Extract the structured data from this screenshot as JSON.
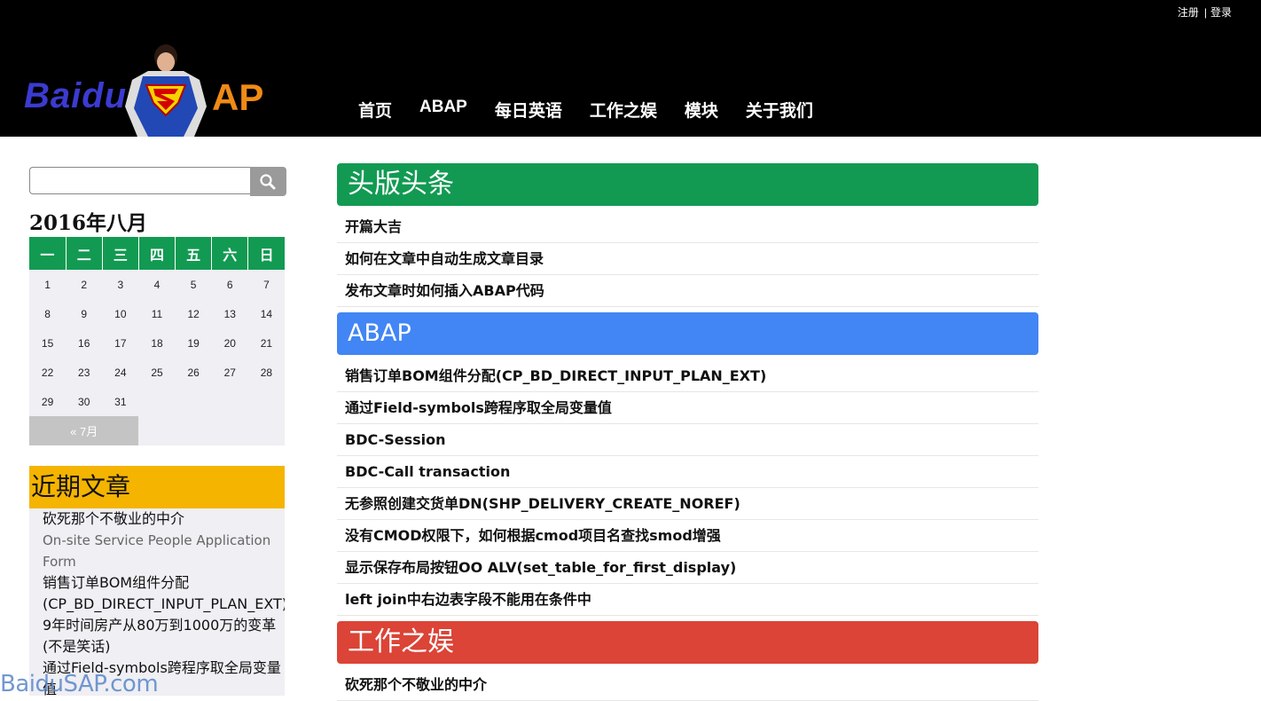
{
  "header": {
    "top_links": [
      "注册",
      "登录"
    ],
    "logo": {
      "left_text": "Baidu",
      "right_text": "AP"
    },
    "nav": [
      "首页",
      "ABAP",
      "每日英语",
      "工作之娱",
      "模块",
      "关于我们"
    ]
  },
  "sidebar": {
    "search": {
      "value": "",
      "icon": "search-icon"
    },
    "calendar": {
      "title": "2016年八月",
      "weekdays": [
        "一",
        "二",
        "三",
        "四",
        "五",
        "六",
        "日"
      ],
      "weeks": [
        [
          "1",
          "2",
          "3",
          "4",
          "5",
          "6",
          "7"
        ],
        [
          "8",
          "9",
          "10",
          "11",
          "12",
          "13",
          "14"
        ],
        [
          "15",
          "16",
          "17",
          "18",
          "19",
          "20",
          "21"
        ],
        [
          "22",
          "23",
          "24",
          "25",
          "26",
          "27",
          "28"
        ],
        [
          "29",
          "30",
          "31",
          "",
          "",
          "",
          ""
        ]
      ],
      "prev_link": "« 7月"
    },
    "recent": {
      "title": "近期文章",
      "items": [
        "砍死那个不敬业的中介",
        "On-site Service People Application Form",
        "销售订单BOM组件分配(CP_BD_DIRECT_INPUT_PLAN_EXT)",
        "9年时间房产从80万到1000万的变革(不是笑话)",
        "通过Field-symbols跨程序取全局变量值"
      ]
    }
  },
  "watermark": "BaiduSAP.com",
  "sections": [
    {
      "title": "头版头条",
      "color": "#129a52",
      "items": [
        "开篇大吉",
        "如何在文章中自动生成文章目录",
        "发布文章时如何插入ABAP代码"
      ]
    },
    {
      "title": "ABAP",
      "color": "#4285f4",
      "items": [
        "销售订单BOM组件分配(CP_BD_DIRECT_INPUT_PLAN_EXT)",
        "通过Field-symbols跨程序取全局变量值",
        "BDC-Session",
        "BDC-Call transaction",
        "无参照创建交货单DN(SHP_DELIVERY_CREATE_NOREF)",
        "没有CMOD权限下，如何根据cmod项目名查找smod增强",
        "显示保存布局按钮OO ALV(set_table_for_first_display)",
        "left join中右边表字段不能用在条件中"
      ]
    },
    {
      "title": "工作之娱",
      "color": "#db4437",
      "items": [
        "砍死那个不敬业的中介"
      ]
    }
  ]
}
